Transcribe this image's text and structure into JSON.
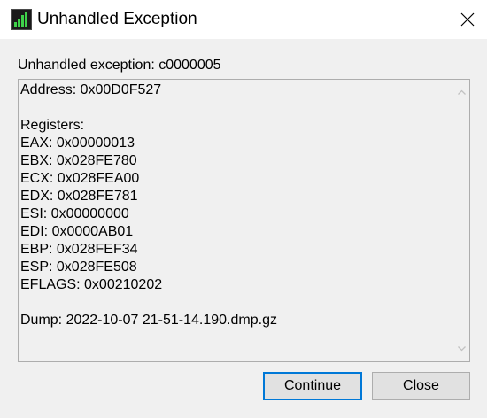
{
  "window": {
    "title": "Unhandled Exception",
    "app_icon": "signal-bars-icon",
    "close_icon": "close-icon"
  },
  "exception": {
    "label": "Unhandled exception: c0000005"
  },
  "details": {
    "text": "Address: 0x00D0F527\n\nRegisters:\nEAX: 0x00000013\nEBX: 0x028FE780\nECX: 0x028FEA00\nEDX: 0x028FE781\nESI: 0x00000000\nEDI: 0x0000AB01\nEBP: 0x028FEF34\nESP: 0x028FE508\nEFLAGS: 0x00210202\n\nDump: 2022-10-07 21-51-14.190.dmp.gz"
  },
  "buttons": {
    "continue_label": "Continue",
    "close_label": "Close"
  },
  "colors": {
    "accent": "#0078d7",
    "icon_green": "#3fd14a"
  }
}
